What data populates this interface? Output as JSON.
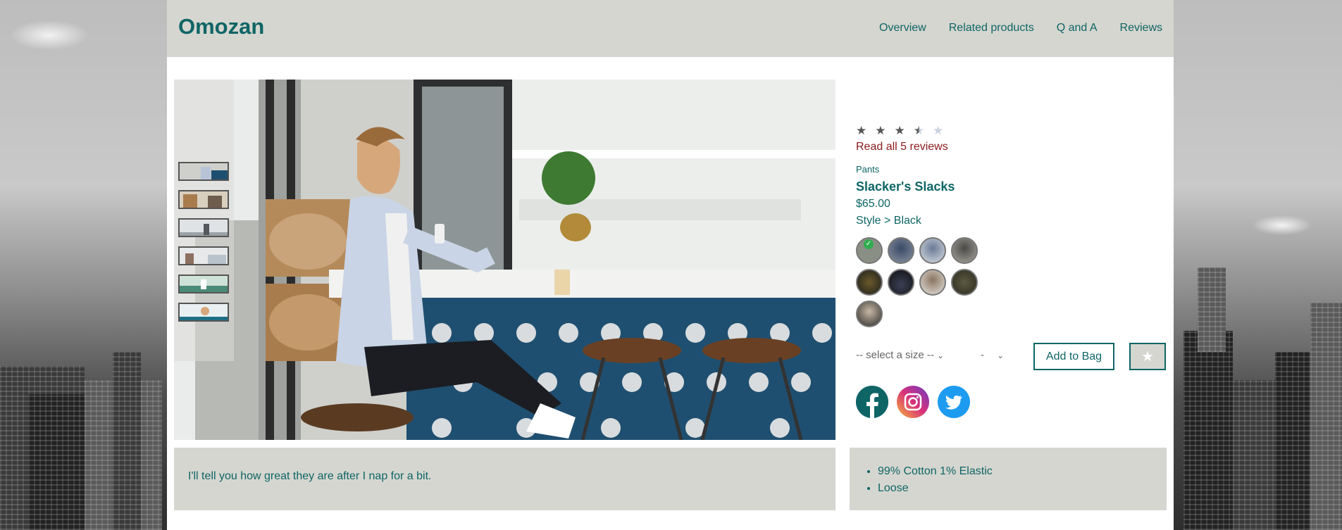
{
  "header": {
    "brand": "Omozan",
    "nav": [
      "Overview",
      "Related products",
      "Q and A",
      "Reviews"
    ]
  },
  "product": {
    "rating": 3.5,
    "rating_max": 5,
    "reviews_link": "Read all 5 reviews",
    "category": "Pants",
    "name": "Slacker's Slacks",
    "price": "$65.00",
    "style_prefix": "Style >",
    "style_name": "Black",
    "style_line": "Style > Black",
    "styles_count": 9,
    "selected_style_index": 0
  },
  "cart": {
    "size_placeholder": "-- select a size --",
    "quantity_placeholder": "-",
    "add_to_bag_label": "Add to Bag",
    "favorite_icon": "star-icon"
  },
  "social": [
    "facebook-icon",
    "instagram-icon",
    "twitter-icon"
  ],
  "description": "I'll tell you how great they are after I nap for a bit.",
  "features": [
    "99% Cotton 1% Elastic",
    "Loose"
  ],
  "colors": {
    "accent": "#0f6565",
    "link": "#8b1a1a",
    "panel": "#d5d6d0"
  },
  "gallery": {
    "thumbnail_count": 6
  }
}
